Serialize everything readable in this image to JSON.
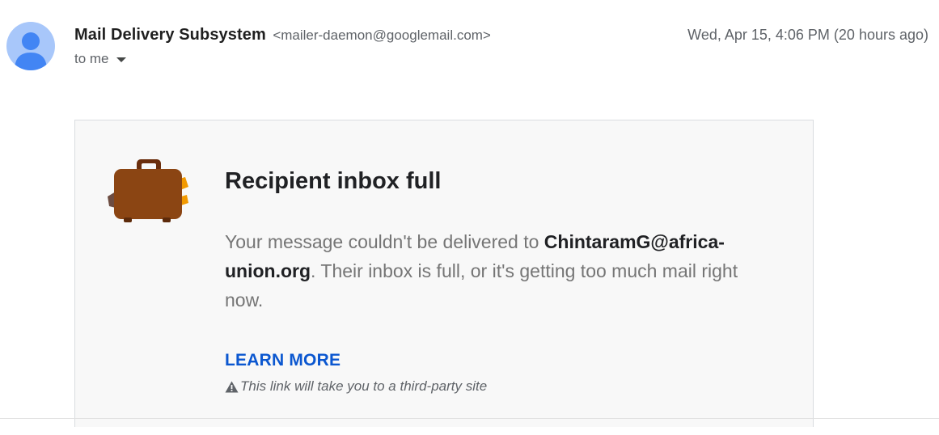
{
  "header": {
    "sender_name": "Mail Delivery Subsystem",
    "sender_email": "<mailer-daemon@googlemail.com>",
    "to_label": "to me",
    "date": "Wed, Apr 15, 4:06 PM (20 hours ago)"
  },
  "card": {
    "icon": "suitcase-icon",
    "title": "Recipient inbox full",
    "body_prefix": "Your message couldn't be delivered to ",
    "recipient": "ChintaramG@africa-union.org",
    "body_suffix": ". Their inbox is full, or it's getting too much mail right now.",
    "learn_more": "LEARN MORE",
    "disclaimer_icon": "warning-icon",
    "disclaimer": "This link will take you to a third-party site"
  },
  "colors": {
    "avatar_bg": "#a8c7fa",
    "avatar_fg": "#4285f4",
    "suitcase": "#8b4513",
    "link": "#0b57d0",
    "card_bg": "#f8f8f8"
  }
}
